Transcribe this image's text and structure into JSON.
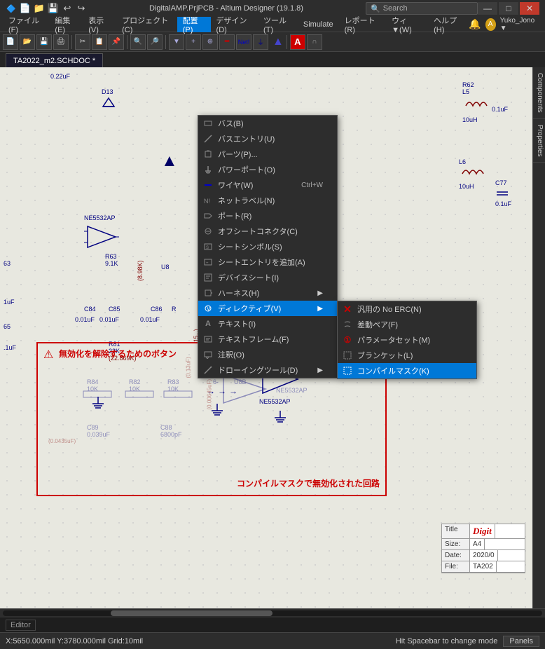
{
  "titlebar": {
    "icons": [
      "📁",
      "💾",
      "✂",
      "📋"
    ],
    "title": "DigitalAMP.PrjPCB - Altium Designer (19.1.8)",
    "search_placeholder": "Search",
    "controls": [
      "—",
      "□",
      "✕"
    ]
  },
  "menubar": {
    "items": [
      {
        "label": "ファイル(F)",
        "id": "file"
      },
      {
        "label": "編集(E)",
        "id": "edit"
      },
      {
        "label": "表示(V)",
        "id": "view"
      },
      {
        "label": "プロジェクト(C)",
        "id": "project"
      },
      {
        "label": "配置(P)",
        "id": "haichi",
        "active": true
      },
      {
        "label": "デザイン(D)",
        "id": "design"
      },
      {
        "label": "ツール(T)",
        "id": "tools"
      },
      {
        "label": "Simulate",
        "id": "simulate"
      },
      {
        "label": "レポート(R)",
        "id": "report"
      },
      {
        "label": "ウィ...(W)",
        "id": "window"
      },
      {
        "label": "ヘルプ(H)",
        "id": "help"
      }
    ]
  },
  "haichi_menu": {
    "items": [
      {
        "label": "バス(B)",
        "id": "bus",
        "icon": "bus"
      },
      {
        "label": "バスエントリ(U)",
        "id": "bus-entry",
        "icon": "bus-entry"
      },
      {
        "label": "パーツ(P)...",
        "id": "parts",
        "icon": "parts"
      },
      {
        "label": "パワーポート(O)",
        "id": "power-port",
        "icon": "power"
      },
      {
        "label": "ワイヤ(W)",
        "shortcut": "Ctrl+W",
        "id": "wire",
        "icon": "wire"
      },
      {
        "label": "ネットラベル(N)",
        "id": "net-label",
        "icon": "net"
      },
      {
        "label": "ポート(R)",
        "id": "port",
        "icon": "port"
      },
      {
        "label": "オフシートコネクタ(C)",
        "id": "offsheet",
        "icon": "offsheet"
      },
      {
        "label": "シートシンボル(S)",
        "id": "sheet-symbol",
        "icon": "sheet"
      },
      {
        "label": "シートエントリを追加(A)",
        "id": "sheet-entry",
        "icon": "sheet-entry"
      },
      {
        "label": "デバイスシート(I)",
        "id": "device-sheet",
        "icon": "device"
      },
      {
        "label": "ハーネス(H)",
        "submenu": true,
        "id": "harness",
        "icon": "harness"
      },
      {
        "label": "ディレクティブ(V)",
        "submenu": true,
        "id": "directive",
        "active": true,
        "icon": "directive"
      },
      {
        "label": "テキスト(I)",
        "id": "text",
        "icon": "text"
      },
      {
        "label": "テキストフレーム(F)",
        "id": "text-frame",
        "icon": "text-frame"
      },
      {
        "label": "注釈(O)",
        "id": "annotation",
        "icon": "annotation"
      },
      {
        "label": "ドローイングツール(D)",
        "submenu": true,
        "id": "drawing",
        "icon": "drawing"
      }
    ]
  },
  "directive_submenu": {
    "items": [
      {
        "label": "汎用の No ERC(N)",
        "id": "no-erc",
        "icon": "x-icon"
      },
      {
        "label": "差動ペア(F)",
        "id": "diff-pair",
        "icon": "diff"
      },
      {
        "label": "パラメータセット(M)",
        "id": "param-set",
        "icon": "param"
      },
      {
        "label": "ブランケット(L)",
        "id": "blanket",
        "icon": "blanket"
      },
      {
        "label": "コンパイルマスク(K)",
        "id": "compile-mask",
        "active": true,
        "icon": "compile"
      }
    ]
  },
  "tab": {
    "label": "TA2022_m2.SCHDOC *"
  },
  "right_panel": {
    "tabs": [
      "Components",
      "Properties"
    ]
  },
  "compile_mask": {
    "icon": "⚠",
    "button_text": "無効化を解除するためのボタン",
    "label": "コンパイルマスクで無効化された回路"
  },
  "title_block": {
    "title_label": "Title",
    "title_value": "Digit",
    "size_label": "Size:",
    "size_value": "A4",
    "date_label": "Date:",
    "date_value": "2020/0",
    "file_label": "File:",
    "file_value": "TA202"
  },
  "statusbar": {
    "coords": "X:5650.000mil Y:3780.000mil  Grid:10mil",
    "hint": "Hit Spacebar to change mode",
    "panels_label": "Panels"
  },
  "editorbar": {
    "label": "Editor"
  }
}
